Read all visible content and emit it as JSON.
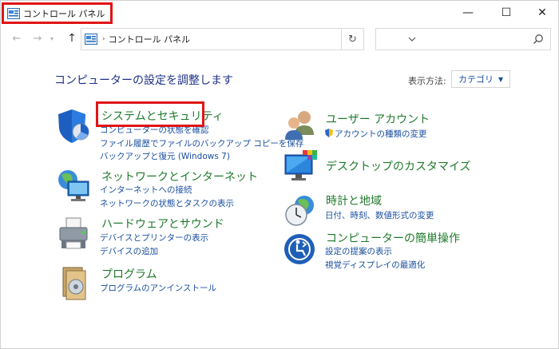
{
  "window": {
    "title": "コントロール パネル",
    "minimize_glyph": "—",
    "maximize_glyph": "☐",
    "close_glyph": "✕"
  },
  "address": {
    "path": "コントロール パネル",
    "separator": "›",
    "refresh_glyph": "↻",
    "search_placeholder": ""
  },
  "nav": {
    "back": "←",
    "forward": "→",
    "recent": "▾",
    "up": "↑"
  },
  "main": {
    "heading": "コンピューターの設定を調整します",
    "view_by_label": "表示方法:",
    "view_by_value": "カテゴリ"
  },
  "categories_left": [
    {
      "icon": "shield-icon",
      "title": "システムとセキュリティ",
      "links": [
        "コンピューターの状態を確認",
        "ファイル履歴でファイルのバックアップ コピーを保存",
        "バックアップと復元 (Windows 7)"
      ]
    },
    {
      "icon": "network-icon",
      "title": "ネットワークとインターネット",
      "links": [
        "インターネットへの接続",
        "ネットワークの状態とタスクの表示"
      ]
    },
    {
      "icon": "printer-icon",
      "title": "ハードウェアとサウンド",
      "links": [
        "デバイスとプリンターの表示",
        "デバイスの追加"
      ]
    },
    {
      "icon": "programs-icon",
      "title": "プログラム",
      "links": [
        "プログラムのアンインストール"
      ]
    }
  ],
  "categories_right": [
    {
      "icon": "users-icon",
      "title": "ユーザー アカウント",
      "links": [
        "アカウントの種類の変更"
      ]
    },
    {
      "icon": "monitor-icon",
      "title": "デスクトップのカスタマイズ",
      "links": []
    },
    {
      "icon": "clock-globe-icon",
      "title": "時計と地域",
      "links": [
        "日付、時刻、数値形式の変更"
      ]
    },
    {
      "icon": "ease-of-access-icon",
      "title": "コンピューターの簡単操作",
      "links": [
        "設定の提案の表示",
        "視覚ディスプレイの最適化"
      ]
    }
  ],
  "colors": {
    "category_title": "#1f7a2c",
    "link": "#1a4fa0",
    "heading": "#1e3287",
    "highlight": "#e01515"
  }
}
